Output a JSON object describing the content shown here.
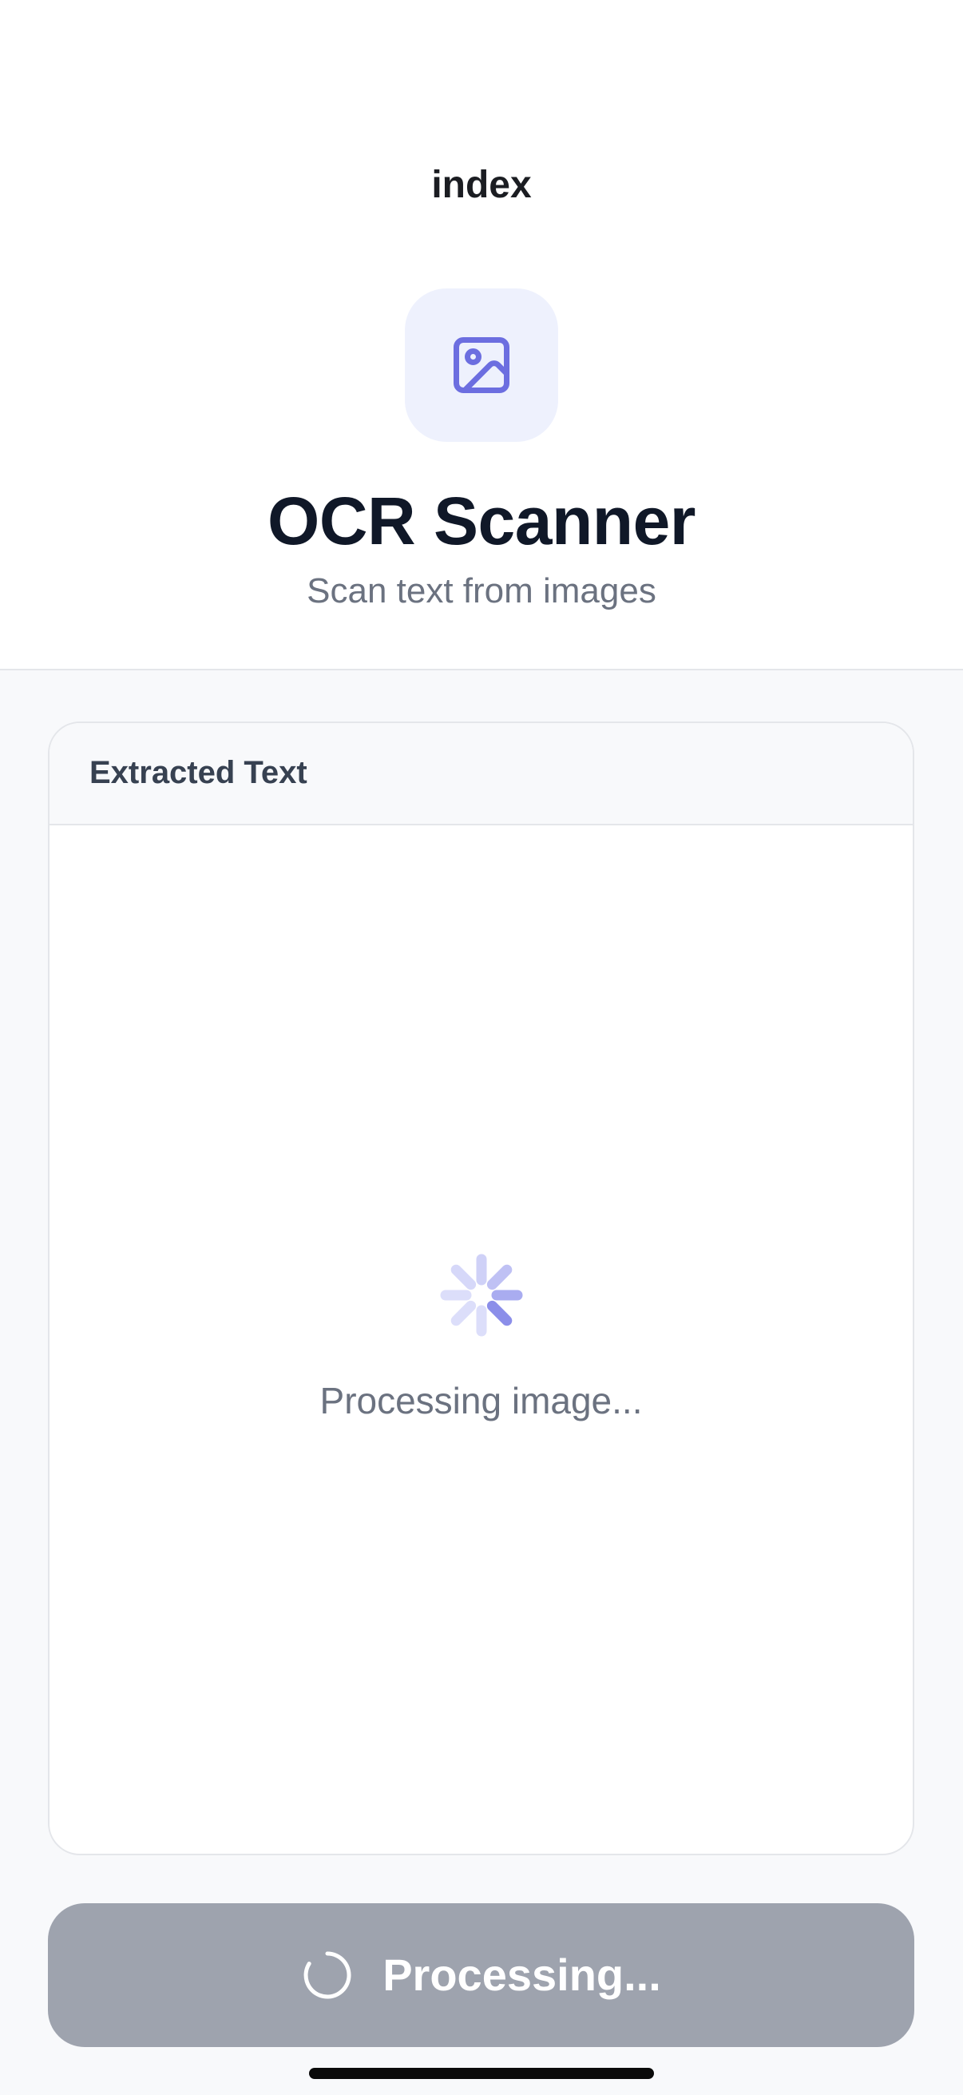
{
  "nav": {
    "title": "index"
  },
  "app": {
    "title": "OCR Scanner",
    "subtitle": "Scan text from images",
    "logo_icon": "image-icon"
  },
  "result_card": {
    "title": "Extracted Text",
    "status_text": "Processing image...",
    "spinner_icon": "spinner-icon"
  },
  "action_button": {
    "label": "Processing...",
    "icon": "loading-icon",
    "state": "disabled"
  },
  "colors": {
    "accent": "#6c6ee0",
    "accent_light": "#eef1fd",
    "title_text": "#101828",
    "muted_text": "#6b7280",
    "button_disabled": "#9ea3ae",
    "background": "#f8f9fb",
    "border": "#e4e6ea"
  }
}
